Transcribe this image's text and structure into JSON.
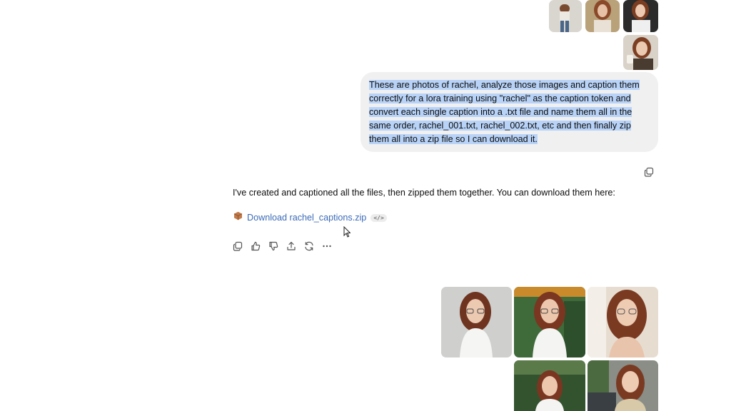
{
  "user_message": {
    "text": "These are photos of rachel, analyze those images and caption them correctly for a lora training using \"rachel\" as the caption token and convert each single caption into a .txt file and name them all in the same order, rachel_001.txt, rachel_002.txt, etc and then finally zip them all into a zip file so I can download it."
  },
  "assistant_message": {
    "text": "I've created and captioned all the files, then zipped them together. You can download them here:",
    "download_link": "Download rachel_captions.zip",
    "code_badge": "</>"
  },
  "icons": {
    "copy_user": "copy-icon",
    "actions": [
      "copy-icon",
      "thumbs-up-icon",
      "thumbs-down-icon",
      "share-icon",
      "regenerate-icon",
      "more-icon"
    ]
  },
  "colors": {
    "bubble": "#f0f0f0",
    "selection": "#b8d3f7",
    "link": "#3b6bb8"
  }
}
